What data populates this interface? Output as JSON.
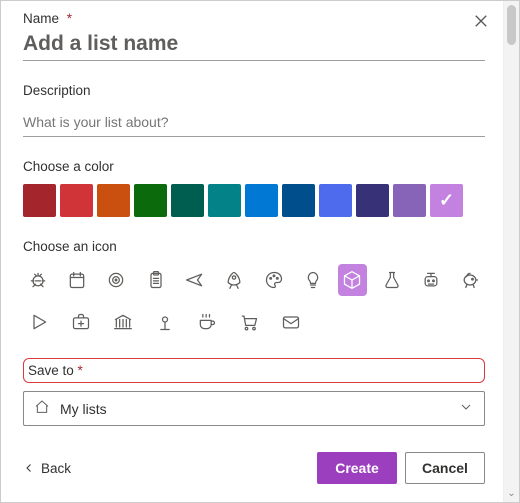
{
  "name": {
    "label": "Name",
    "required_mark": "*",
    "placeholder": "Add a list name",
    "value": ""
  },
  "description": {
    "label": "Description",
    "placeholder": "What is your list about?",
    "value": ""
  },
  "color": {
    "label": "Choose a color",
    "options": [
      "#a4262c",
      "#d13438",
      "#ca5010",
      "#0b6a0b",
      "#005e50",
      "#038387",
      "#0078d4",
      "#004e8c",
      "#4f6bed",
      "#373277",
      "#8764b8",
      "#c482e0"
    ],
    "selected_index": 11
  },
  "icon": {
    "label": "Choose an icon",
    "items": [
      "bug",
      "calendar",
      "target",
      "clipboard",
      "airplane",
      "rocket",
      "palette",
      "lightbulb",
      "cube",
      "flask",
      "robot",
      "piggy-bank",
      "play",
      "first-aid",
      "bank",
      "location",
      "coffee",
      "cart",
      "mail"
    ],
    "selected_index": 8
  },
  "save_to": {
    "label": "Save to",
    "required_mark": "*",
    "value": "My lists"
  },
  "footer": {
    "back": "Back",
    "create": "Create",
    "cancel": "Cancel"
  }
}
